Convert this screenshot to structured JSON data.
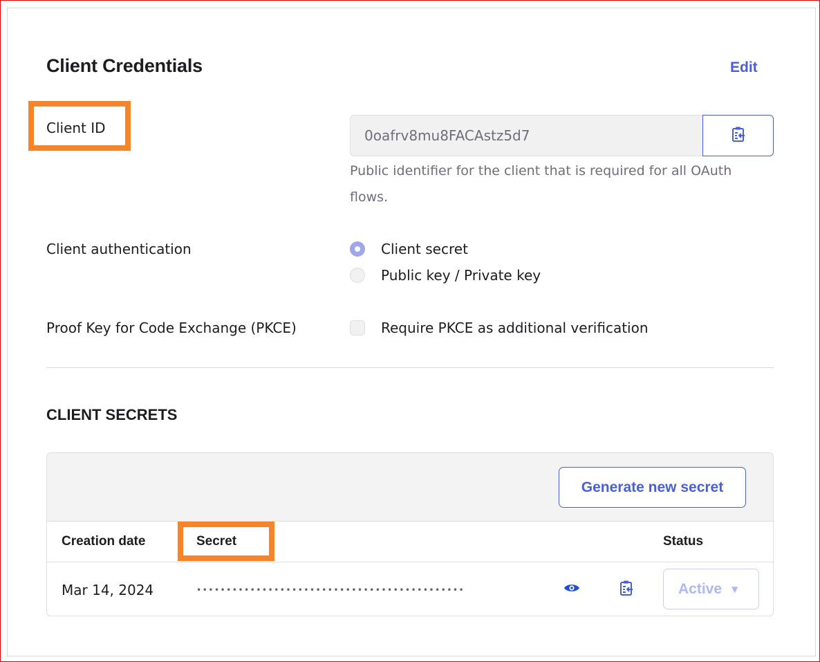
{
  "header": {
    "title": "Client Credentials",
    "edit_label": "Edit"
  },
  "client_id": {
    "label": "Client ID",
    "value": "0oafrv8mu8FACAstz5d7",
    "help": "Public identifier for the client that is required for all OAuth flows.",
    "copy_icon": "clipboard-copy-icon"
  },
  "client_auth": {
    "label": "Client authentication",
    "options": [
      {
        "label": "Client secret",
        "selected": true
      },
      {
        "label": "Public key / Private key",
        "selected": false
      }
    ]
  },
  "pkce": {
    "label": "Proof Key for Code Exchange (PKCE)",
    "option_label": "Require PKCE as additional verification",
    "checked": false
  },
  "secrets": {
    "section_title": "CLIENT SECRETS",
    "generate_label": "Generate new secret",
    "columns": {
      "date": "Creation date",
      "secret": "Secret",
      "status": "Status"
    },
    "rows": [
      {
        "date": "Mar 14, 2024",
        "masked": "•••••••••••••••••••••••••••••••••••••••••••••",
        "status": "Active",
        "reveal_icon": "eye-icon",
        "copy_icon": "clipboard-copy-icon"
      }
    ]
  },
  "colors": {
    "accent": "#4a5fd6",
    "highlight": "#f5842b",
    "frame": "#e20000"
  }
}
